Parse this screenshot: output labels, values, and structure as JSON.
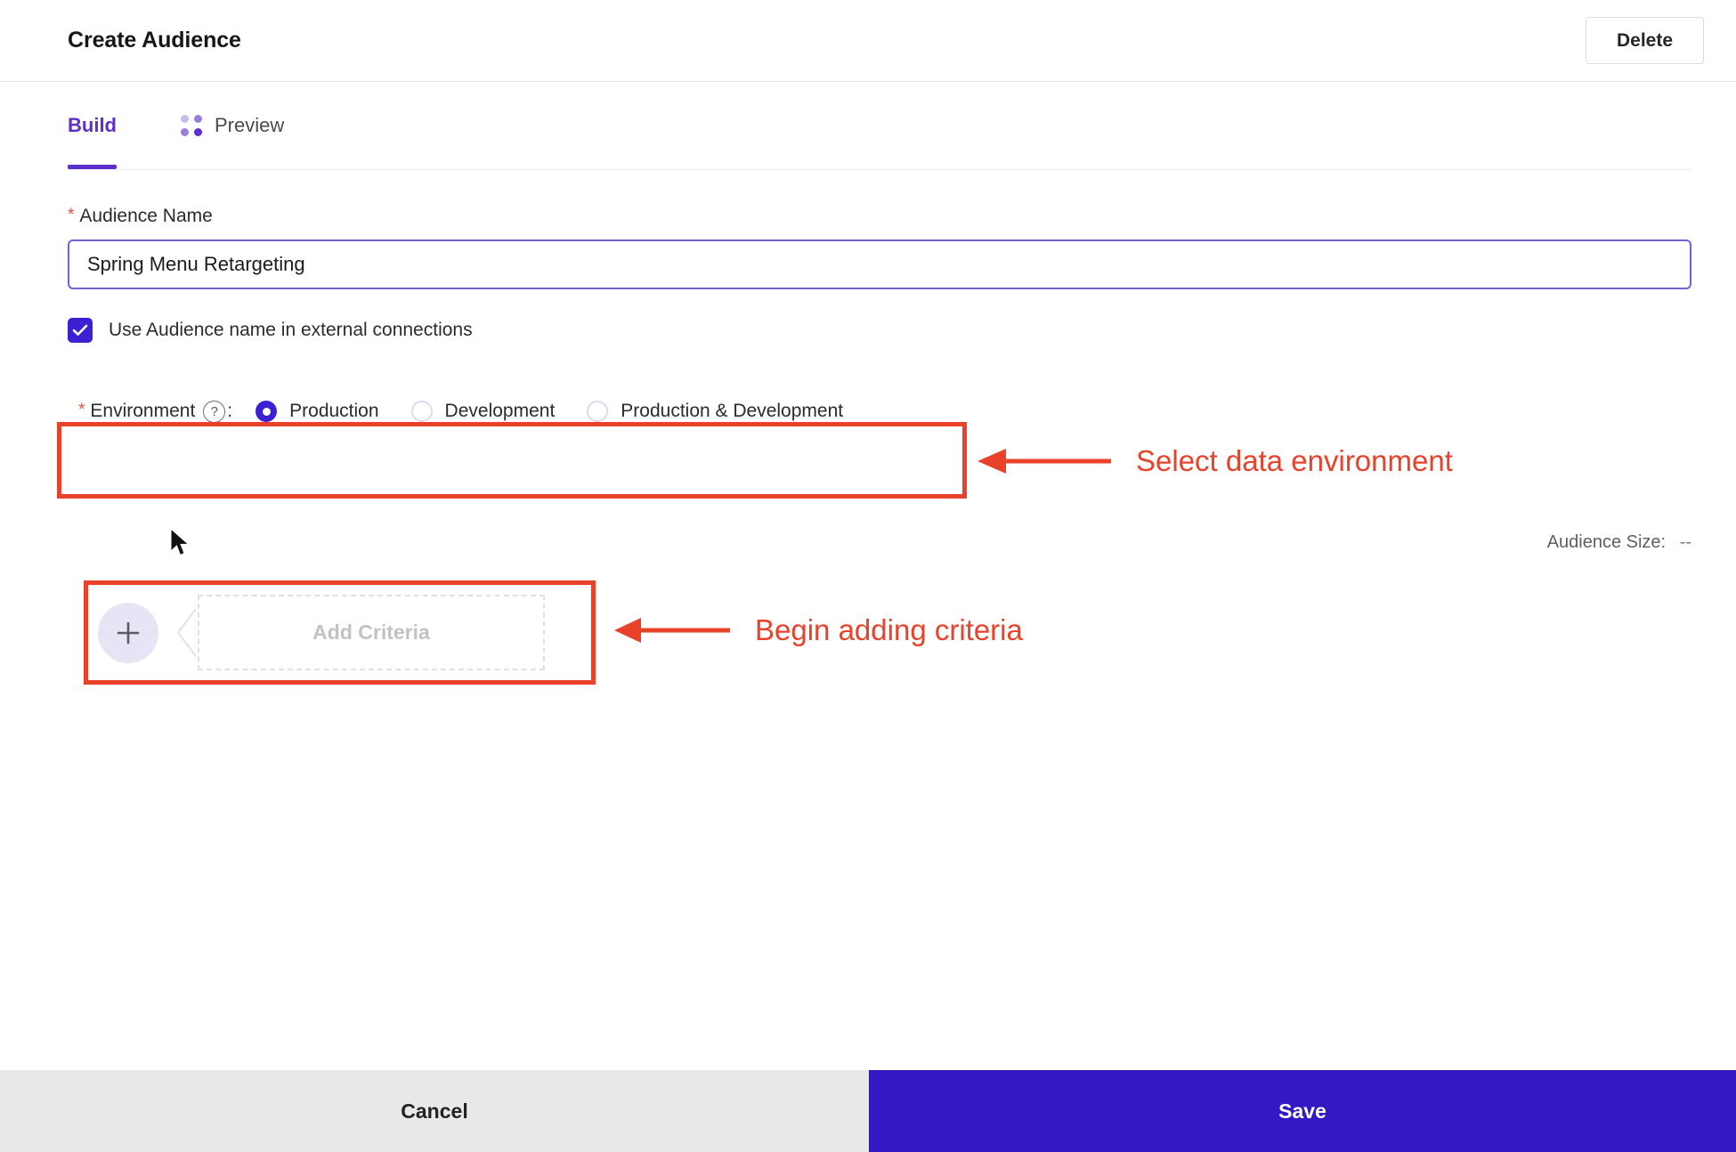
{
  "header": {
    "title": "Create Audience",
    "delete_label": "Delete"
  },
  "tabs": [
    {
      "label": "Build",
      "active": true,
      "icon": null
    },
    {
      "label": "Preview",
      "active": false,
      "icon": "four-dots-icon"
    }
  ],
  "form": {
    "audience_name": {
      "label": "Audience Name",
      "required_marker": "*",
      "value": "Spring Menu Retargeting",
      "placeholder": "Audience Name"
    },
    "external_connections_checkbox": {
      "label": "Use Audience name in external connections",
      "checked": true
    },
    "environment": {
      "label": "Environment",
      "required_marker": "*",
      "help_icon": "question-mark-icon",
      "colon": ":",
      "options": [
        {
          "label": "Production",
          "selected": true
        },
        {
          "label": "Development",
          "selected": false
        },
        {
          "label": "Production & Development",
          "selected": false
        }
      ]
    }
  },
  "audience_size": {
    "label": "Audience Size:",
    "value": "--"
  },
  "criteria": {
    "add_label": "Add Criteria",
    "plus_icon": "plus-icon"
  },
  "annotations": [
    {
      "text": "Select data environment",
      "arrow": "arrow-left-icon"
    },
    {
      "text": "Begin adding criteria",
      "arrow": "arrow-left-icon"
    }
  ],
  "footer": {
    "cancel_label": "Cancel",
    "save_label": "Save"
  },
  "colors": {
    "accent_purple": "#5b2fc9",
    "brand_blue": "#3318c4",
    "checkbox_blue": "#3d1fd4",
    "annotation_red": "#e8422a",
    "required_red": "#e1503a",
    "footer_cancel_bg": "#e9e8e6"
  }
}
